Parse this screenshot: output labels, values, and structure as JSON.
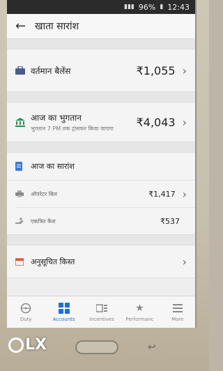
{
  "status_bar": {
    "battery": "96%",
    "time": "12:43"
  },
  "app_bar": {
    "title": "खाता सारांश"
  },
  "balance": {
    "label": "वर्तमान बैलेंस",
    "amount": "₹1,055"
  },
  "payment": {
    "label": "आज का भुगतान",
    "subtitle": "भुगतान 7 PM तक ट्रांसफर किया जाएगा",
    "amount": "₹4,043"
  },
  "summary": {
    "title": "आज का सारांश",
    "rows": [
      {
        "label": "ऑपरेटर बिल",
        "amount": "₹1,417"
      },
      {
        "label": "एकत्रित कैश",
        "amount": "₹537"
      }
    ]
  },
  "installment": {
    "label": "अनुसूचित किस्त"
  },
  "bottom_nav": [
    {
      "label": "Duty"
    },
    {
      "label": "Accounts"
    },
    {
      "label": "Incentives"
    },
    {
      "label": "Performanc"
    },
    {
      "label": "More"
    }
  ],
  "watermark": {
    "text": "LX"
  },
  "colors": {
    "accent": "#1e6fd9",
    "screen_bg": "#eeeeee"
  }
}
